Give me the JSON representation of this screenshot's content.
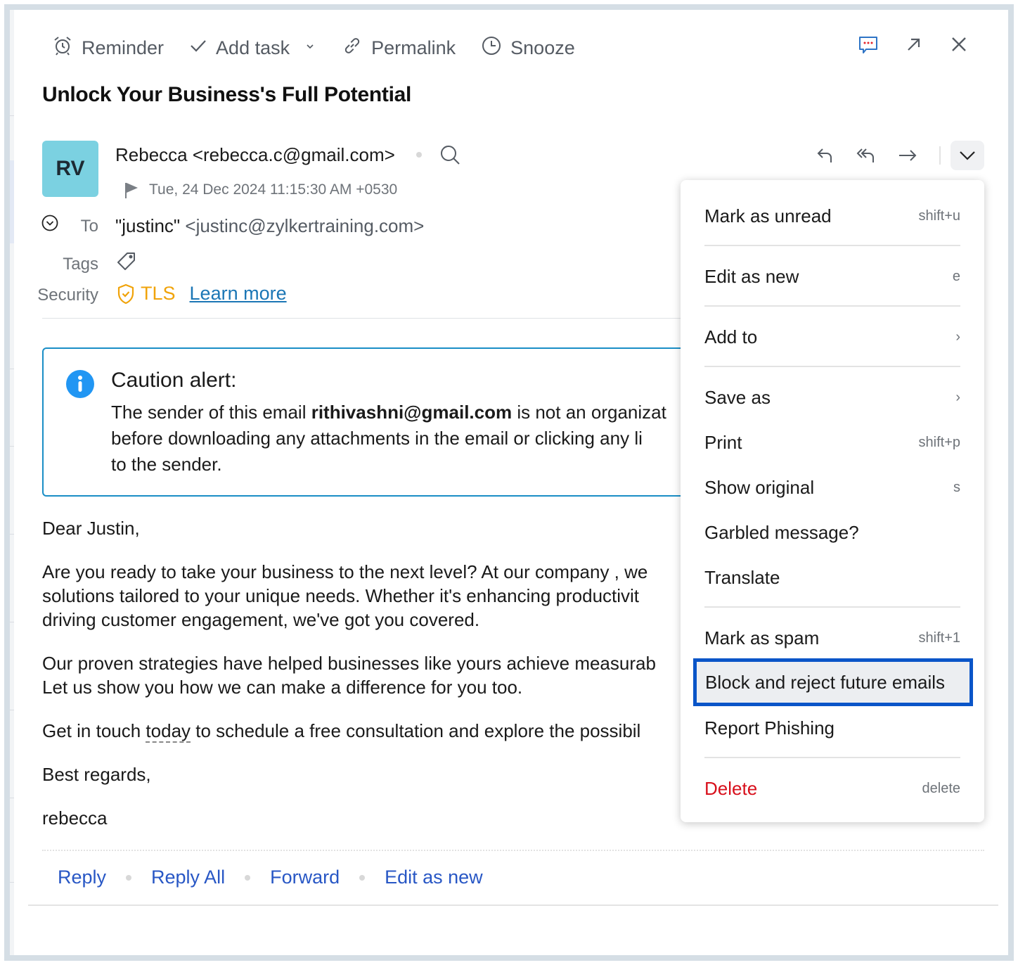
{
  "toolbar": {
    "reminder": "Reminder",
    "add_task": "Add task",
    "permalink": "Permalink",
    "snooze": "Snooze",
    "icons": {
      "reminder": "alarm-clock-icon",
      "add_task": "checkmark-icon",
      "add_task_dropdown": "chevron-down-icon",
      "permalink": "link-icon",
      "snooze": "clock-icon",
      "chat": "chat-bubble-icon",
      "popout": "arrow-up-right-icon",
      "close": "close-icon"
    }
  },
  "email": {
    "subject": "Unlock Your Business's Full Potential",
    "avatar_initials": "RV",
    "avatar_color": "#7bd1e1",
    "sender": "Rebecca <rebecca.c@gmail.com>",
    "date": "Tue, 24 Dec 2024 11:15:30 AM +0530",
    "to_label": "To",
    "to_name": "\"justinc\"",
    "to_address": "<justinc@zylkertraining.com>",
    "tags_label": "Tags",
    "security_label": "Security",
    "security_value": "TLS",
    "security_color": "#f0a30a",
    "learn_more": "Learn more"
  },
  "caution": {
    "title": "Caution alert:",
    "line1_prefix": "The sender of this email ",
    "sender_email": "rithivashni@gmail.com",
    "line1_suffix": " is not an organizat",
    "line2": "before downloading any attachments in the email or clicking any li",
    "line3": "to the sender.",
    "border_color": "#1a8ec6"
  },
  "body": {
    "greeting": "Dear Justin,",
    "p1_l1": "Are you ready to take your business to the next level? At our company , we",
    "p1_l2": "solutions tailored to your unique needs. Whether it's enhancing productivit",
    "p1_l3": "driving customer engagement, we've got you covered.",
    "p2_l1": "Our proven strategies have helped businesses like yours achieve measurab",
    "p2_l2": "Let us show you how we can make a difference for you too.",
    "p3_prefix": "Get in touch ",
    "p3_today": "today",
    "p3_suffix": " to schedule a free consultation and explore the possibil",
    "closing": "Best regards,",
    "signature": "rebecca"
  },
  "reply_bar": {
    "reply": "Reply",
    "reply_all": "Reply All",
    "forward": "Forward",
    "edit_as_new": "Edit as new",
    "link_color": "#2857c5"
  },
  "menu": {
    "items": [
      {
        "label": "Mark as unread",
        "shortcut": "shift+u"
      },
      {
        "label": "Edit as new",
        "shortcut": "e"
      },
      {
        "label": "Add to",
        "shortcut": "›"
      },
      {
        "label": "Save as",
        "shortcut": "›"
      },
      {
        "label": "Print",
        "shortcut": "shift+p"
      },
      {
        "label": "Show original",
        "shortcut": "s"
      },
      {
        "label": "Garbled message?",
        "shortcut": ""
      },
      {
        "label": "Translate",
        "shortcut": ""
      },
      {
        "label": "Mark as spam",
        "shortcut": "shift+1"
      },
      {
        "label": "Block and reject future emails",
        "shortcut": ""
      },
      {
        "label": "Report Phishing",
        "shortcut": ""
      },
      {
        "label": "Delete",
        "shortcut": "delete"
      }
    ],
    "highlighted": "Block and reject future emails",
    "highlight_color": "#0a55c8",
    "delete_color": "#d8101c"
  }
}
